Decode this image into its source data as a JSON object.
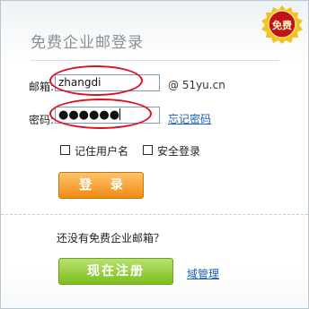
{
  "header": {
    "title": "免费企业邮登录",
    "badge_text": "免费"
  },
  "form": {
    "email_label": "邮箱:",
    "email_value": "zhangdi",
    "domain_suffix": "@ 51yu.cn",
    "password_label": "密码:",
    "password_value": "●●●●●●",
    "forgot_link": "忘记密码"
  },
  "options": {
    "remember_username": "记住用户名",
    "secure_login": "安全登录"
  },
  "login_button": "登 录",
  "register": {
    "question": "还没有免费企业邮箱？",
    "register_button": "现在注册",
    "domain_admin_link": "域管理"
  },
  "colors": {
    "annotation_circle": "#e01020",
    "login_orange": "#f08a14",
    "register_green": "#7cbe1e",
    "link_blue": "#1a5fb4"
  }
}
